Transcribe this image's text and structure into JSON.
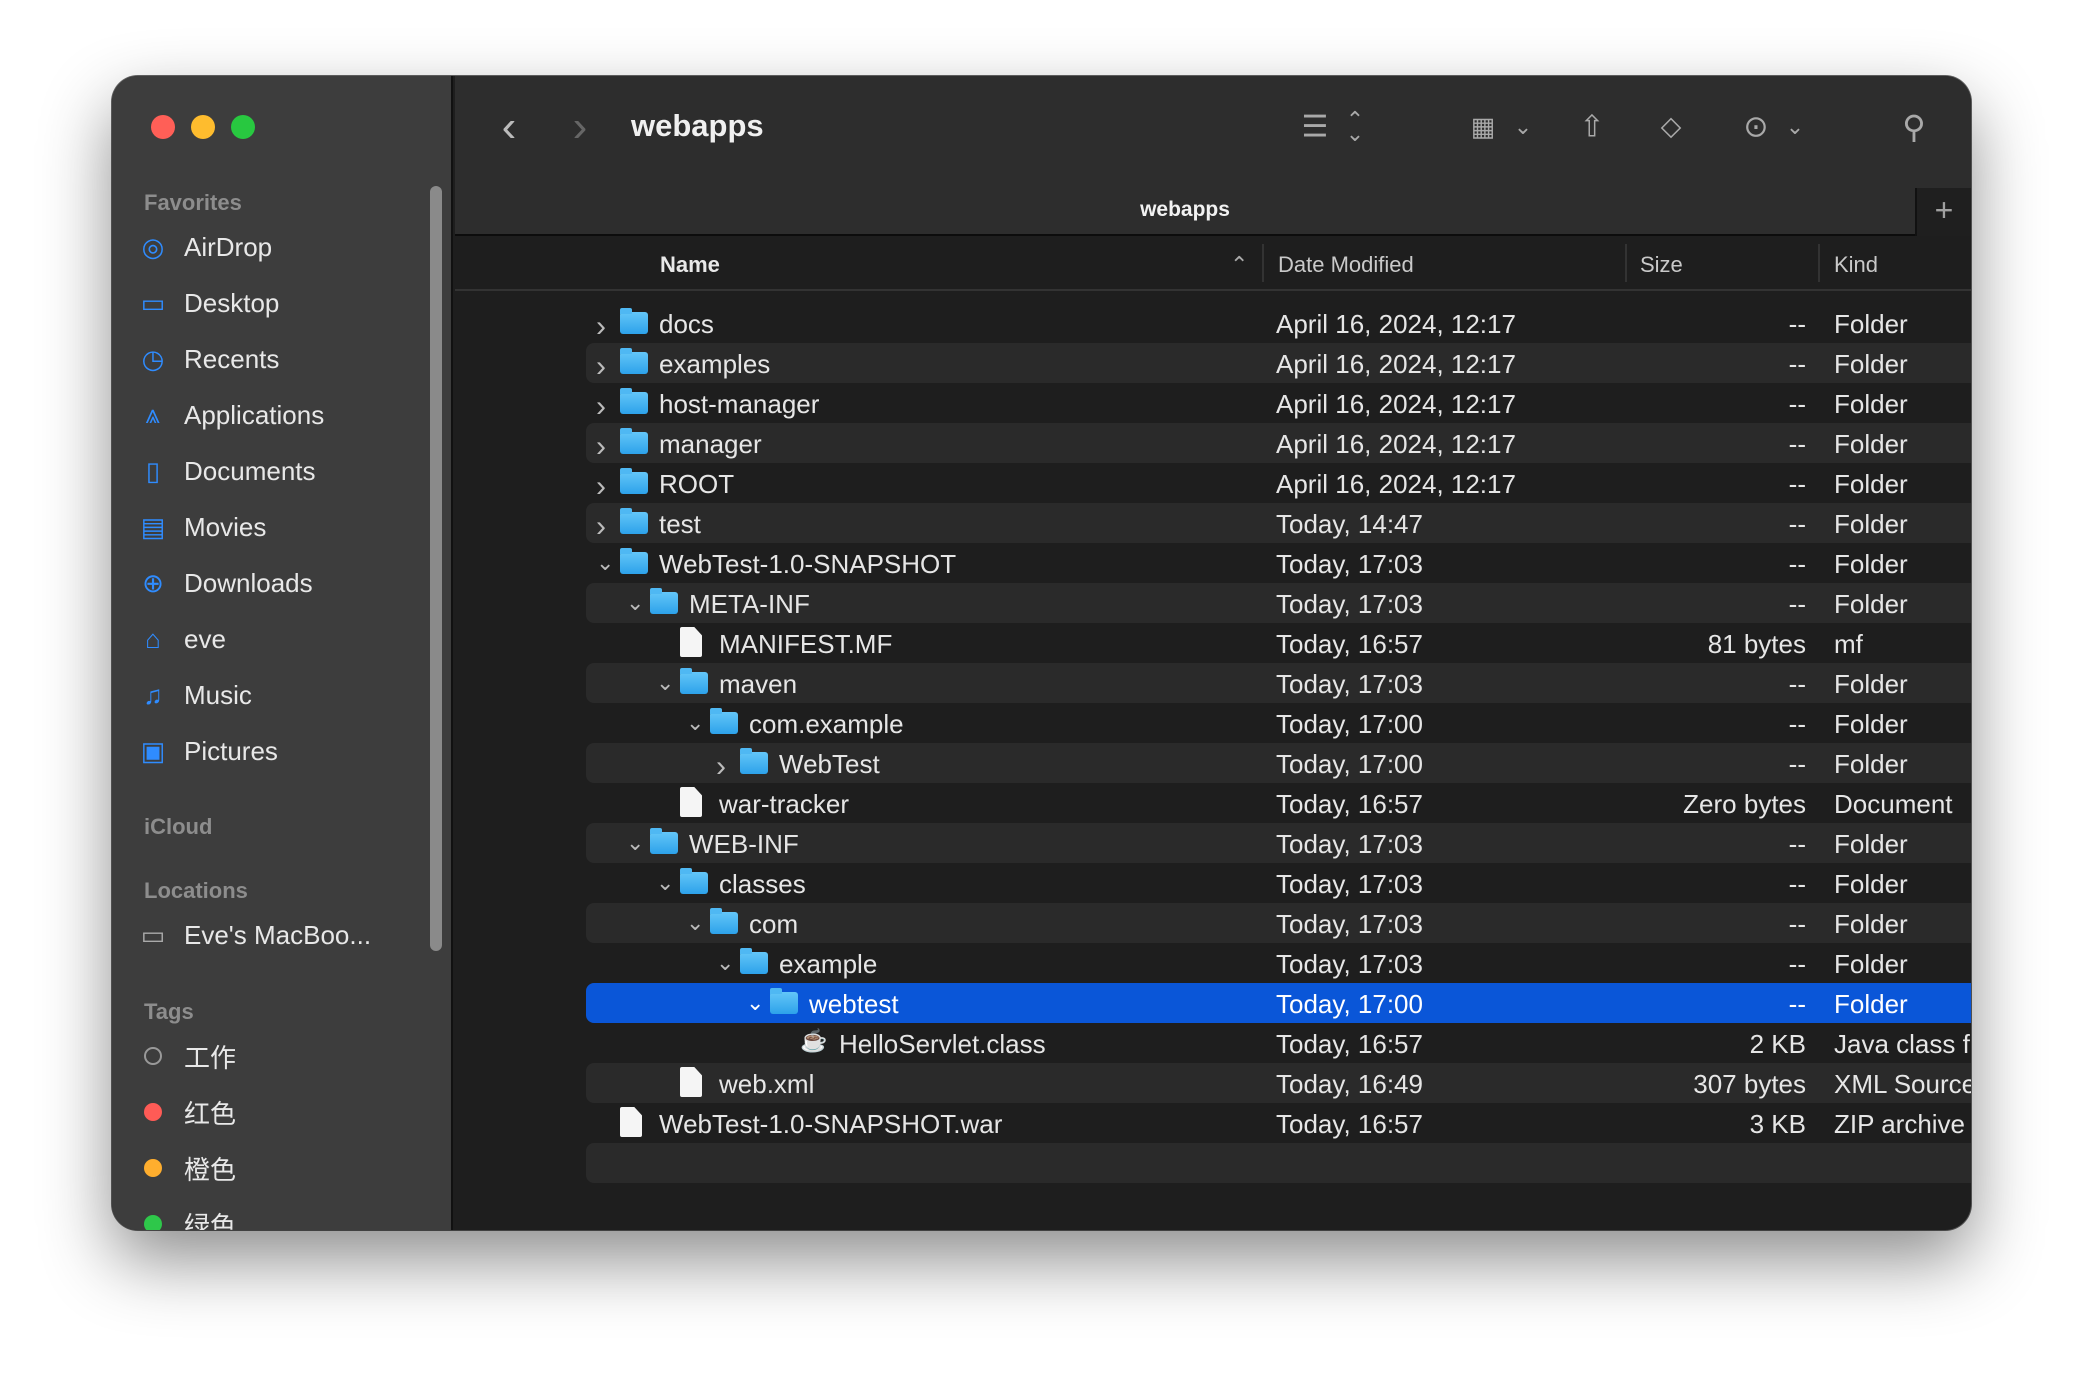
{
  "window": {
    "title": "webapps",
    "path_label": "webapps"
  },
  "toolbar": {
    "back": "‹",
    "forward": "›",
    "icons": [
      "list-view-icon",
      "sort-icon",
      "group-icon",
      "share-icon",
      "tag-icon",
      "more-icon",
      "search-icon"
    ]
  },
  "sidebar": {
    "favorites_heading": "Favorites",
    "favorites": [
      {
        "label": "AirDrop",
        "icon": "airdrop-icon",
        "glyph": "◎"
      },
      {
        "label": "Desktop",
        "icon": "desktop-icon",
        "glyph": "▭"
      },
      {
        "label": "Recents",
        "icon": "clock-icon",
        "glyph": "◷"
      },
      {
        "label": "Applications",
        "icon": "applications-icon",
        "glyph": "⩓"
      },
      {
        "label": "Documents",
        "icon": "document-icon",
        "glyph": "▯"
      },
      {
        "label": "Movies",
        "icon": "film-icon",
        "glyph": "▤"
      },
      {
        "label": "Downloads",
        "icon": "download-icon",
        "glyph": "⊕"
      },
      {
        "label": "eve",
        "icon": "home-icon",
        "glyph": "⌂"
      },
      {
        "label": "Music",
        "icon": "music-icon",
        "glyph": "♫"
      },
      {
        "label": "Pictures",
        "icon": "pictures-icon",
        "glyph": "▣"
      }
    ],
    "icloud_heading": "iCloud",
    "locations_heading": "Locations",
    "locations": [
      {
        "label": "Eve's MacBoo...",
        "icon": "laptop-icon",
        "glyph": "▭"
      }
    ],
    "tags_heading": "Tags",
    "tags": [
      {
        "label": "工作",
        "color": "none"
      },
      {
        "label": "红色",
        "color": "#ff5b56"
      },
      {
        "label": "橙色",
        "color": "#ffae2e"
      },
      {
        "label": "绿色",
        "color": "#2ec74a"
      }
    ]
  },
  "columns": {
    "name": "Name",
    "date": "Date Modified",
    "size": "Size",
    "kind": "Kind"
  },
  "rows": [
    {
      "name": "docs",
      "depth": 0,
      "exp": "closed",
      "icon": "folder",
      "date": "April 16, 2024, 12:17",
      "size": "--",
      "kind": "Folder"
    },
    {
      "name": "examples",
      "depth": 0,
      "exp": "closed",
      "icon": "folder",
      "date": "April 16, 2024, 12:17",
      "size": "--",
      "kind": "Folder"
    },
    {
      "name": "host-manager",
      "depth": 0,
      "exp": "closed",
      "icon": "folder",
      "date": "April 16, 2024, 12:17",
      "size": "--",
      "kind": "Folder"
    },
    {
      "name": "manager",
      "depth": 0,
      "exp": "closed",
      "icon": "folder",
      "date": "April 16, 2024, 12:17",
      "size": "--",
      "kind": "Folder"
    },
    {
      "name": "ROOT",
      "depth": 0,
      "exp": "closed",
      "icon": "folder",
      "date": "April 16, 2024, 12:17",
      "size": "--",
      "kind": "Folder"
    },
    {
      "name": "test",
      "depth": 0,
      "exp": "closed",
      "icon": "folder",
      "date": "Today, 14:47",
      "size": "--",
      "kind": "Folder"
    },
    {
      "name": "WebTest-1.0-SNAPSHOT",
      "depth": 0,
      "exp": "open",
      "icon": "folder",
      "date": "Today, 17:03",
      "size": "--",
      "kind": "Folder"
    },
    {
      "name": "META-INF",
      "depth": 1,
      "exp": "open",
      "icon": "folder",
      "date": "Today, 17:03",
      "size": "--",
      "kind": "Folder"
    },
    {
      "name": "MANIFEST.MF",
      "depth": 2,
      "exp": "",
      "icon": "file",
      "date": "Today, 16:57",
      "size": "81 bytes",
      "kind": "mf"
    },
    {
      "name": "maven",
      "depth": 2,
      "exp": "open",
      "icon": "folder",
      "date": "Today, 17:03",
      "size": "--",
      "kind": "Folder"
    },
    {
      "name": "com.example",
      "depth": 3,
      "exp": "open",
      "icon": "folder",
      "date": "Today, 17:00",
      "size": "--",
      "kind": "Folder"
    },
    {
      "name": "WebTest",
      "depth": 4,
      "exp": "closed",
      "icon": "folder",
      "date": "Today, 17:00",
      "size": "--",
      "kind": "Folder"
    },
    {
      "name": "war-tracker",
      "depth": 2,
      "exp": "",
      "icon": "file",
      "date": "Today, 16:57",
      "size": "Zero bytes",
      "kind": "Document"
    },
    {
      "name": "WEB-INF",
      "depth": 1,
      "exp": "open",
      "icon": "folder",
      "date": "Today, 17:03",
      "size": "--",
      "kind": "Folder"
    },
    {
      "name": "classes",
      "depth": 2,
      "exp": "open",
      "icon": "folder",
      "date": "Today, 17:03",
      "size": "--",
      "kind": "Folder"
    },
    {
      "name": "com",
      "depth": 3,
      "exp": "open",
      "icon": "folder",
      "date": "Today, 17:03",
      "size": "--",
      "kind": "Folder"
    },
    {
      "name": "example",
      "depth": 4,
      "exp": "open",
      "icon": "folder",
      "date": "Today, 17:03",
      "size": "--",
      "kind": "Folder"
    },
    {
      "name": "webtest",
      "depth": 5,
      "exp": "open",
      "icon": "folder",
      "date": "Today, 17:00",
      "size": "--",
      "kind": "Folder",
      "selected": true
    },
    {
      "name": "HelloServlet.class",
      "depth": 6,
      "exp": "",
      "icon": "java",
      "date": "Today, 16:57",
      "size": "2 KB",
      "kind": "Java class file"
    },
    {
      "name": "web.xml",
      "depth": 2,
      "exp": "",
      "icon": "file",
      "date": "Today, 16:49",
      "size": "307 bytes",
      "kind": "XML Source File"
    },
    {
      "name": "WebTest-1.0-SNAPSHOT.war",
      "depth": 0,
      "exp": "",
      "icon": "file",
      "date": "Today, 16:57",
      "size": "3 KB",
      "kind": "ZIP archive"
    }
  ],
  "colors": {
    "selection": "#0a56d8",
    "folder": "#3aaef0"
  }
}
